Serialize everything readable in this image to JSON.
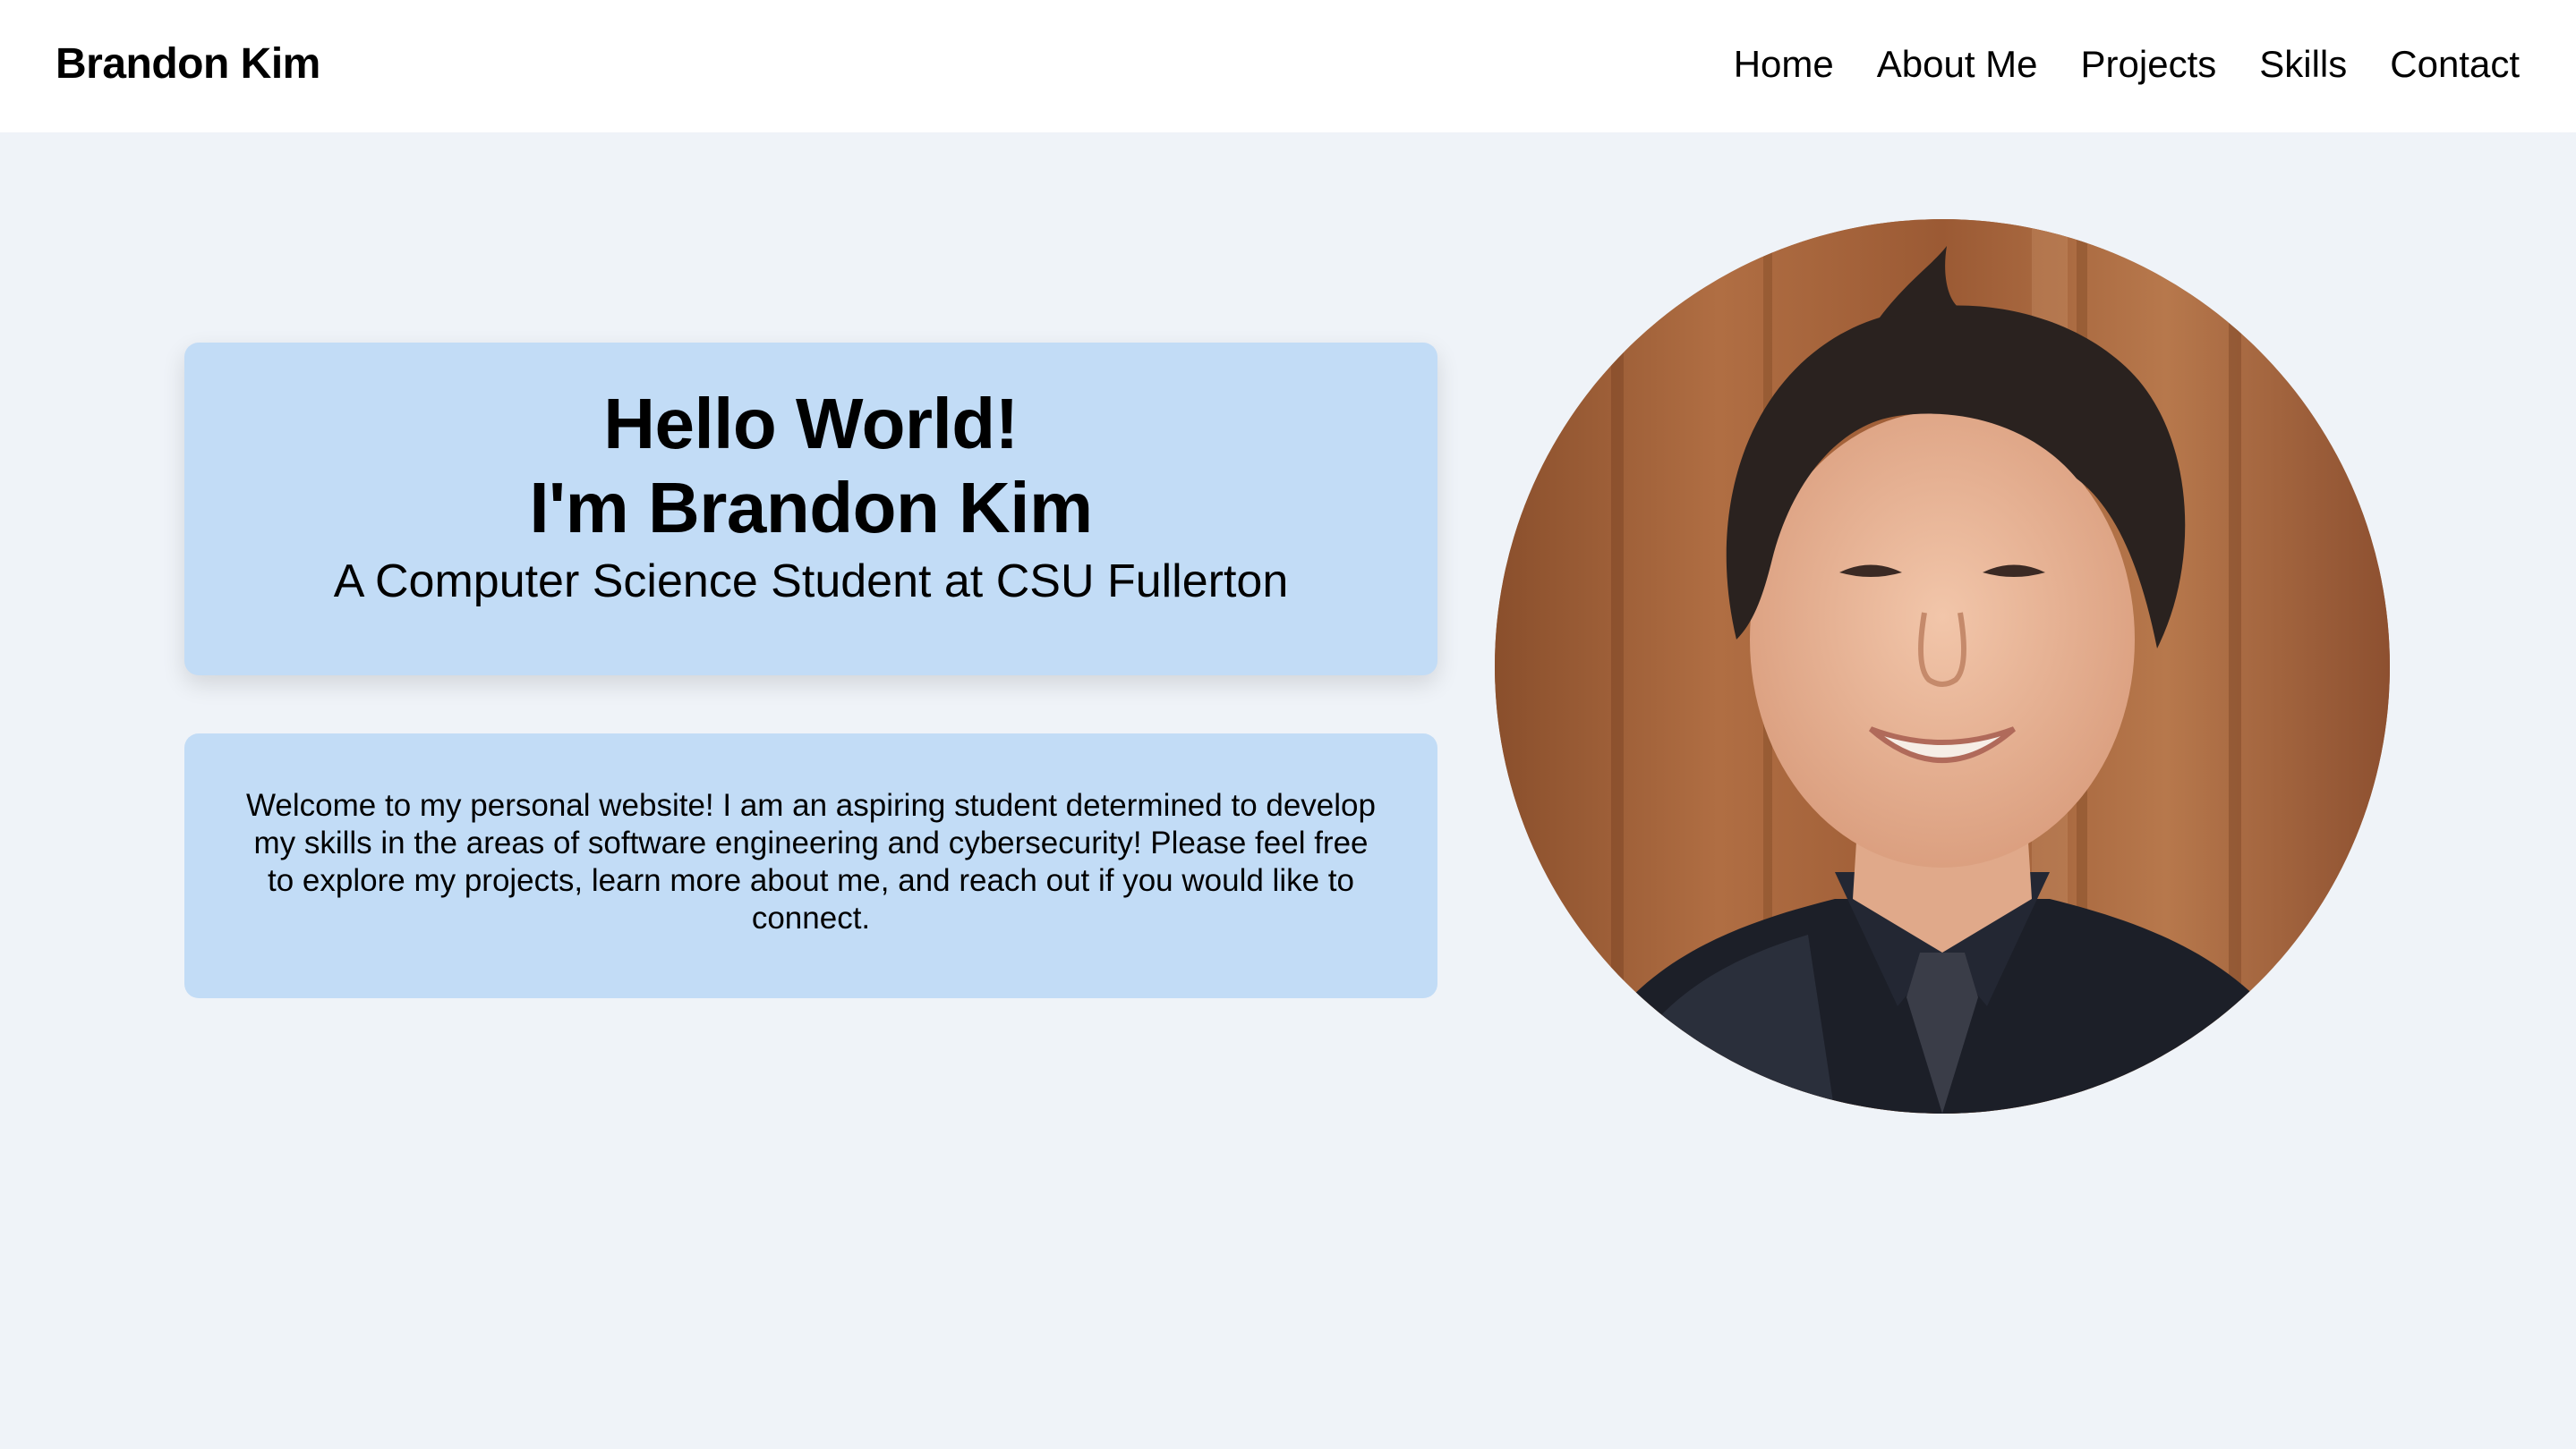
{
  "header": {
    "brand": "Brandon Kim",
    "nav": [
      {
        "label": "Home"
      },
      {
        "label": "About Me"
      },
      {
        "label": "Projects"
      },
      {
        "label": "Skills"
      },
      {
        "label": "Contact"
      }
    ]
  },
  "hero": {
    "line1": "Hello World!",
    "line2": "I'm Brandon Kim",
    "subtitle": "A Computer Science Student at CSU Fullerton"
  },
  "intro": {
    "text": "Welcome to my personal website! I am an aspiring student determined to develop my skills in the areas of software engineering and cybersecurity! Please feel free to explore my projects, learn more about me, and reach out if you would like to connect."
  },
  "colors": {
    "page_bg": "#eff3f8",
    "card_bg": "#c2dcf6",
    "header_bg": "#ffffff",
    "text": "#000000"
  },
  "icons": {
    "portrait": "profile-photo"
  }
}
